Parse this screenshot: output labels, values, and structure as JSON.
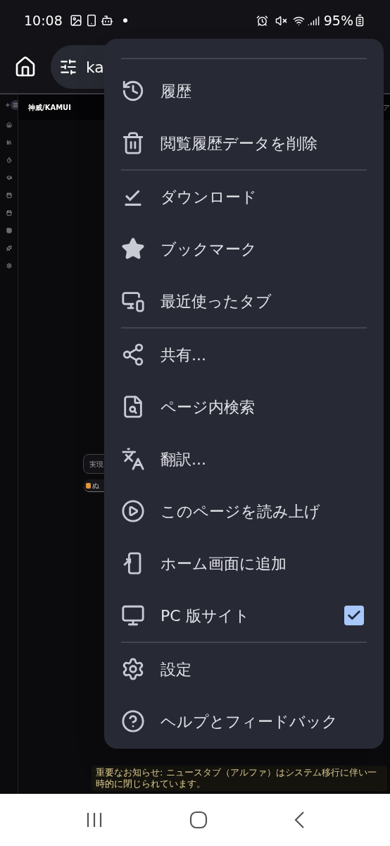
{
  "status_bar": {
    "time": "10:08",
    "battery": "95%"
  },
  "toolbar": {
    "url_text": "ka"
  },
  "page": {
    "title": "神威/KAMUI",
    "edge_text": "ア",
    "center_button": "実現",
    "chip": "ぬ",
    "notice": "重要なお知らせ: ニュースタブ（アルファ）はシステム移行に伴い一時的に閉じられています。"
  },
  "menu": {
    "sections": [
      [
        {
          "kind": "item",
          "label": "履歴"
        },
        {
          "kind": "item",
          "label": "閲覧履歴データを削除"
        }
      ],
      [
        {
          "kind": "item",
          "label": "ダウンロード"
        },
        {
          "kind": "item",
          "label": "ブックマーク"
        },
        {
          "kind": "item",
          "label": "最近使ったタブ"
        }
      ],
      [
        {
          "kind": "item",
          "label": "共有..."
        },
        {
          "kind": "item",
          "label": "ページ内検索"
        },
        {
          "kind": "item",
          "label": "翻訳..."
        },
        {
          "kind": "item",
          "label": "このページを読み上げ"
        },
        {
          "kind": "item",
          "label": "ホーム画面に追加"
        },
        {
          "kind": "checkbox",
          "label": "PC 版サイト",
          "checked": true
        }
      ],
      [
        {
          "kind": "item",
          "label": "設定"
        },
        {
          "kind": "item",
          "label": "ヘルプとフィードバック"
        }
      ]
    ]
  }
}
